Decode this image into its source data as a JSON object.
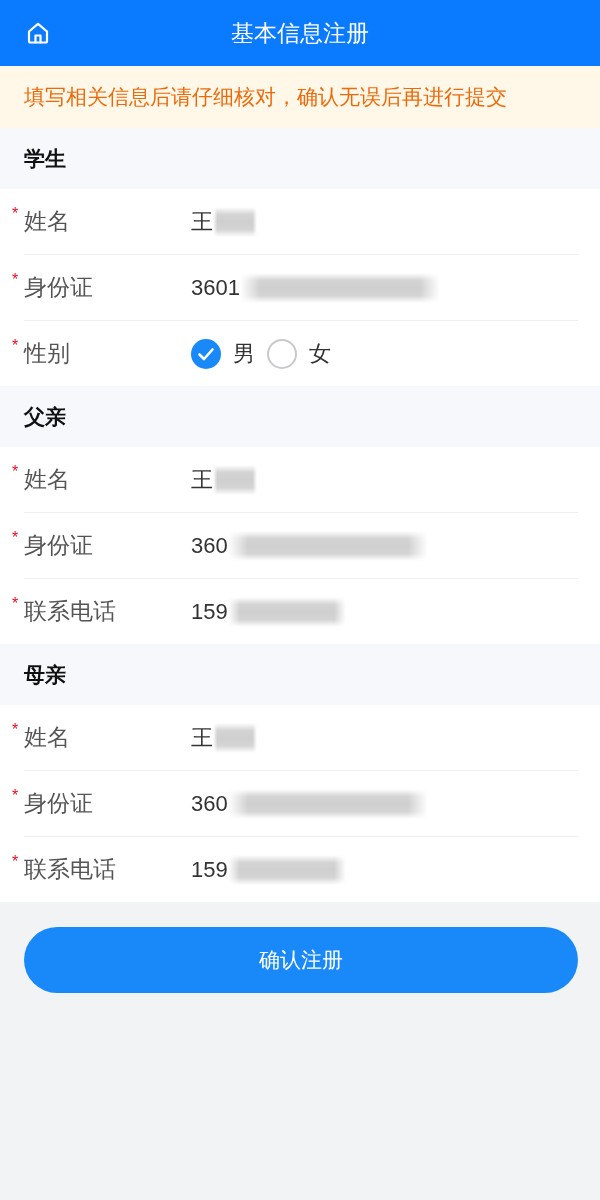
{
  "header": {
    "title": "基本信息注册"
  },
  "notice": {
    "text": "填写相关信息后请仔细核对，确认无误后再进行提交"
  },
  "sections": [
    {
      "title": "学生",
      "rows": [
        {
          "kind": "name",
          "required_mark": "*",
          "label": "姓名",
          "value": "王",
          "redacted": true
        },
        {
          "kind": "id_number",
          "required_mark": "*",
          "label": "身份证",
          "value": "3601",
          "redacted": true
        },
        {
          "kind": "radio",
          "required_mark": "*",
          "label": "性别",
          "options": [
            {
              "label": "男",
              "selected": true
            },
            {
              "label": "女",
              "selected": false
            }
          ]
        }
      ]
    },
    {
      "title": "父亲",
      "rows": [
        {
          "kind": "name",
          "required_mark": "*",
          "label": "姓名",
          "value": "王",
          "redacted": true
        },
        {
          "kind": "id_number",
          "required_mark": "*",
          "label": "身份证",
          "value": "360",
          "redacted": true
        },
        {
          "kind": "phone",
          "required_mark": "*",
          "label": "联系电话",
          "value": "159",
          "redacted": true
        }
      ]
    },
    {
      "title": "母亲",
      "rows": [
        {
          "kind": "name",
          "required_mark": "*",
          "label": "姓名",
          "value": "王",
          "redacted": true
        },
        {
          "kind": "id_number",
          "required_mark": "*",
          "label": "身份证",
          "value": "360",
          "redacted": true
        },
        {
          "kind": "phone",
          "required_mark": "*",
          "label": "联系电话",
          "value": "159",
          "redacted": true
        }
      ]
    }
  ],
  "submit_button": {
    "label": "确认注册"
  }
}
